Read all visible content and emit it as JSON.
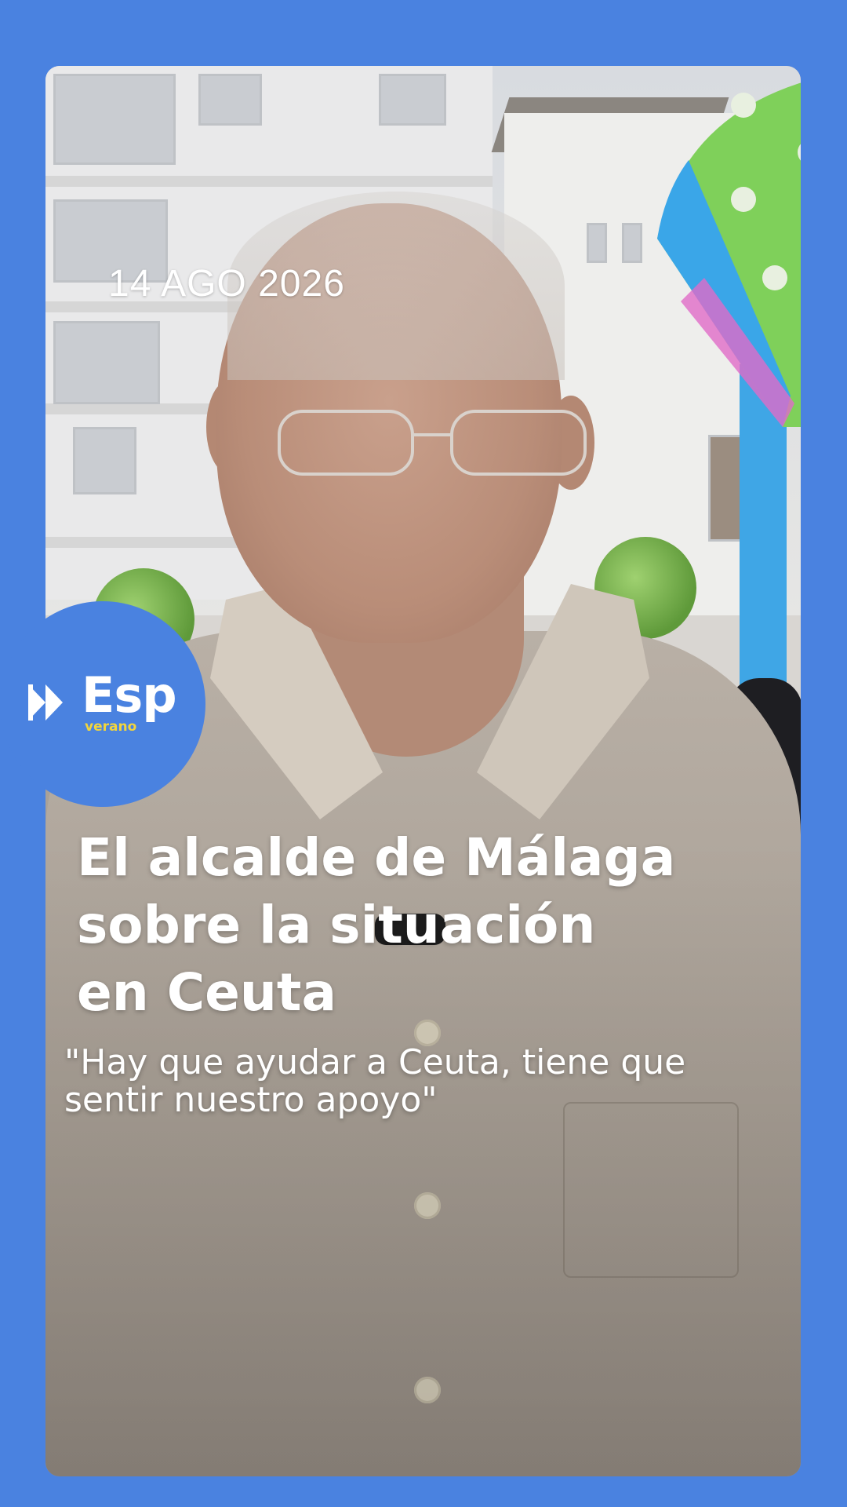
{
  "story": {
    "date": "14 AGO 2026",
    "headline_lines": [
      "El alcalde de Málaga",
      "sobre la situación",
      "en Ceuta"
    ],
    "quote_lines": [
      "\"Hay que ayudar a Ceuta, tiene que",
      "sentir nuestro apoyo\""
    ]
  },
  "brand": {
    "name": "Esp",
    "tagline": "verano",
    "circle_color": "#4a82e0",
    "tagline_color": "#f2d53c",
    "icon": "double-play-icon"
  },
  "colors": {
    "background": "#4a82e0",
    "text": "#ffffff"
  }
}
